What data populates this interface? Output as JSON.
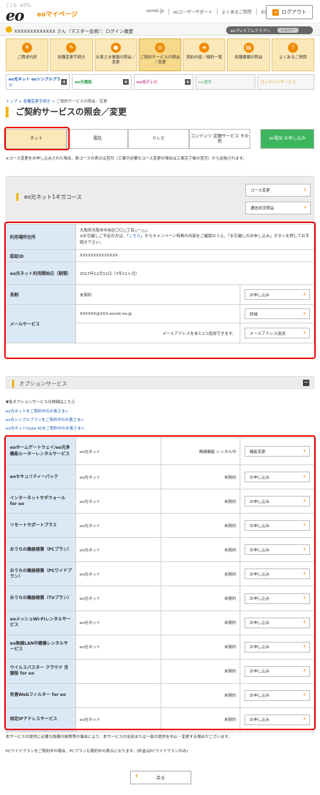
{
  "header": {
    "tagline": "こころ、はずむ。",
    "logo": "eo",
    "logo_sub": "eoマイページ",
    "links": [
      "eonet.jp",
      "eoユーザーサポート",
      "よくあるご質問",
      "お問い合わせ"
    ],
    "logout_label": "ログアウト"
  },
  "user_bar": {
    "text": "XXXXXXXXXXXXX さん（マスター会員）：ログイン履歴",
    "premium_label": "eoプレミアムクラブへ",
    "rank": "シルバー"
  },
  "nav": [
    {
      "label": "ご請求内訳",
      "icon": "¥"
    },
    {
      "label": "各種変更手続き",
      "icon": "✎"
    },
    {
      "label": "お客さま情報の照会／変更",
      "icon": "●"
    },
    {
      "label": "ご契約サービスの照会／変更",
      "icon": "◎"
    },
    {
      "label": "契約内容／規約一覧",
      "icon": "≡"
    },
    {
      "label": "各種書類の照会",
      "icon": "▤"
    },
    {
      "label": "よくあるご質問",
      "icon": "?"
    }
  ],
  "service_tabs": [
    {
      "label": "eo光ネット eoシンプルプラン",
      "color": "#1a5fb4"
    },
    {
      "label": "eo光電話",
      "color": "#2e9e45"
    },
    {
      "label": "eo光テレビ",
      "color": "#c84b8c"
    },
    {
      "label": "eo電気",
      "color": "#9ad0a8"
    },
    {
      "label": "コンテンツサービス",
      "color": "#e9c774"
    }
  ],
  "breadcrumb": [
    "トップ",
    "各種変更手続き",
    "ご契約サービスの照会／変更"
  ],
  "page_title": "ご契約サービスの照会／変更",
  "tabs": [
    "ネット",
    "電話",
    "テレビ",
    "コンテンツ 定額サービス その他",
    "eo電気 お申し込み"
  ],
  "note_course": "※コース変更をお申し込みされた場合、新コースの表示は翌月（工事が必要なコース変更の場合は工事完了後の翌月）から反映されます。",
  "course": {
    "name": "eo光ネット1ギガコース",
    "buttons": [
      "コース変更",
      "通信状況照会"
    ]
  },
  "details": {
    "address_label": "利用場所住所",
    "address_value": "大阪府大阪市中央区〇〇△丁目△ー△△",
    "address_note_pre": "※お引越しご予定の方は、「",
    "address_note_link": "こちら",
    "address_note_post": "」からキャンペーン特典の内容をご確認のうえ、「お引越しのお申し込み」ボタンを押してお手続き下さい。",
    "id_label": "認証ID",
    "id_value": "XXXXXXXXXXXXXX",
    "start_label": "eo光ネット利用開始日（期間）",
    "start_value": "2017年12月12日（7年11ヶ月）",
    "long_label": "長割",
    "long_value": "未契約",
    "long_button": "お申し込み",
    "mail_label": "メールサービス",
    "mail_value": "XXXXXX@XXX.eonet.ne.jp",
    "mail_button": "詳細",
    "mail_add_text": "メールアドレスをあと1つ追加できます。",
    "mail_add_button": "メールアドレス追加"
  },
  "options": {
    "title": "オプションサービス",
    "info_title": "▼各オプションサービスの詳細はこちら",
    "links": [
      "eo光ネットをご契約中のお客さま>",
      "eo光シンプルプランをご契約中のお客さま>",
      "eo光ネット(type N)をご契約中のお客さま>"
    ],
    "rows": [
      {
        "name": "eoホームゲートウェイ/eo光多機能ルーターレンタルサービス",
        "plan": "eo光ネット",
        "status": "無線機能 レンタル中",
        "button": "機能変更"
      },
      {
        "name": "eoセキュリティーパック",
        "plan": "eo光ネット",
        "status": "未契約",
        "button": "お申し込み"
      },
      {
        "name": "インターネットサギウォール for eo",
        "plan": "eo光ネット",
        "status": "未契約",
        "button": "お申し込み"
      },
      {
        "name": "リモートサポートプラス",
        "plan": "eo光ネット",
        "status": "未契約",
        "button": "お申し込み"
      },
      {
        "name": "おうちの機器補償（PCプラン）",
        "plan": "eo光ネット",
        "status": "未契約",
        "button": "お申し込み"
      },
      {
        "name": "おうちの機器補償（PCワイドプラン）",
        "plan": "eo光ネット",
        "status": "未契約",
        "button": "お申し込み"
      },
      {
        "name": "おうちの機器補償（TVプラン）",
        "plan": "eo光ネット",
        "status": "未契約",
        "button": "お申し込み"
      },
      {
        "name": "eoメッシュWi-Fiレンタルサービス",
        "plan": "eo光ネット",
        "status": "未契約",
        "button": "お申し込み"
      },
      {
        "name": "eo無線LAN中継機レンタルサービス",
        "plan": "eo光ネット",
        "status": "未契約",
        "button": "お申し込み"
      },
      {
        "name": "ウイルスバスター クラウド 月額版 for eo",
        "plan": "",
        "status": "未契約",
        "button": "お申し込み"
      },
      {
        "name": "有害Webフィルター for eo",
        "plan": "",
        "status": "未契約",
        "button": "お申し込み"
      },
      {
        "name": "固定IPアドレスサービス",
        "plan": "eo光ネット",
        "status": "未契約",
        "button": "お申し込み"
      }
    ]
  },
  "footer_note1": "本サービスの提供に必要な設備の故障等の事由により、本サービスの全部または一部の提供を中止・変更する場合がございます。",
  "footer_note2": "PCワイドプランをご契約中の場合、PCプランも契約中の表示になります。(料金はPCワイドプランのみ)",
  "back_label": "戻る"
}
